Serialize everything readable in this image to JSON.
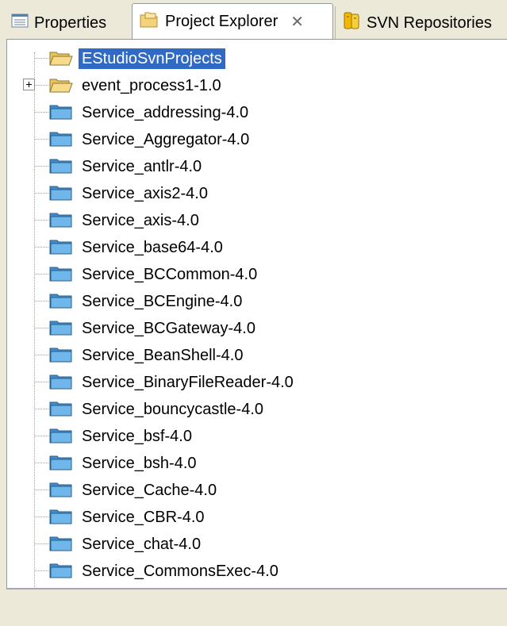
{
  "tabs": {
    "properties": "Properties",
    "project_explorer": "Project Explorer",
    "project_explorer_close": "✕",
    "svn_repositories": "SVN Repositories"
  },
  "tree": {
    "root": "EStudioSvnProjects",
    "items": [
      {
        "label": "event_process1-1.0",
        "icon": "open-folder-icon",
        "expandable": true
      },
      {
        "label": "Service_addressing-4.0",
        "icon": "folder-icon"
      },
      {
        "label": "Service_Aggregator-4.0",
        "icon": "folder-icon"
      },
      {
        "label": "Service_antlr-4.0",
        "icon": "folder-icon"
      },
      {
        "label": "Service_axis2-4.0",
        "icon": "folder-icon"
      },
      {
        "label": "Service_axis-4.0",
        "icon": "folder-icon"
      },
      {
        "label": "Service_base64-4.0",
        "icon": "folder-icon"
      },
      {
        "label": "Service_BCCommon-4.0",
        "icon": "folder-icon"
      },
      {
        "label": "Service_BCEngine-4.0",
        "icon": "folder-icon"
      },
      {
        "label": "Service_BCGateway-4.0",
        "icon": "folder-icon"
      },
      {
        "label": "Service_BeanShell-4.0",
        "icon": "folder-icon"
      },
      {
        "label": "Service_BinaryFileReader-4.0",
        "icon": "folder-icon"
      },
      {
        "label": "Service_bouncycastle-4.0",
        "icon": "folder-icon"
      },
      {
        "label": "Service_bsf-4.0",
        "icon": "folder-icon"
      },
      {
        "label": "Service_bsh-4.0",
        "icon": "folder-icon"
      },
      {
        "label": "Service_Cache-4.0",
        "icon": "folder-icon"
      },
      {
        "label": "Service_CBR-4.0",
        "icon": "folder-icon"
      },
      {
        "label": "Service_chat-4.0",
        "icon": "folder-icon"
      },
      {
        "label": "Service_CommonsExec-4.0",
        "icon": "folder-icon"
      }
    ]
  },
  "colors": {
    "selection": "#316ac5",
    "folder_blue": "#4f9fd8",
    "folder_open": "#f2c94c",
    "chrome": "#ece9d8"
  }
}
